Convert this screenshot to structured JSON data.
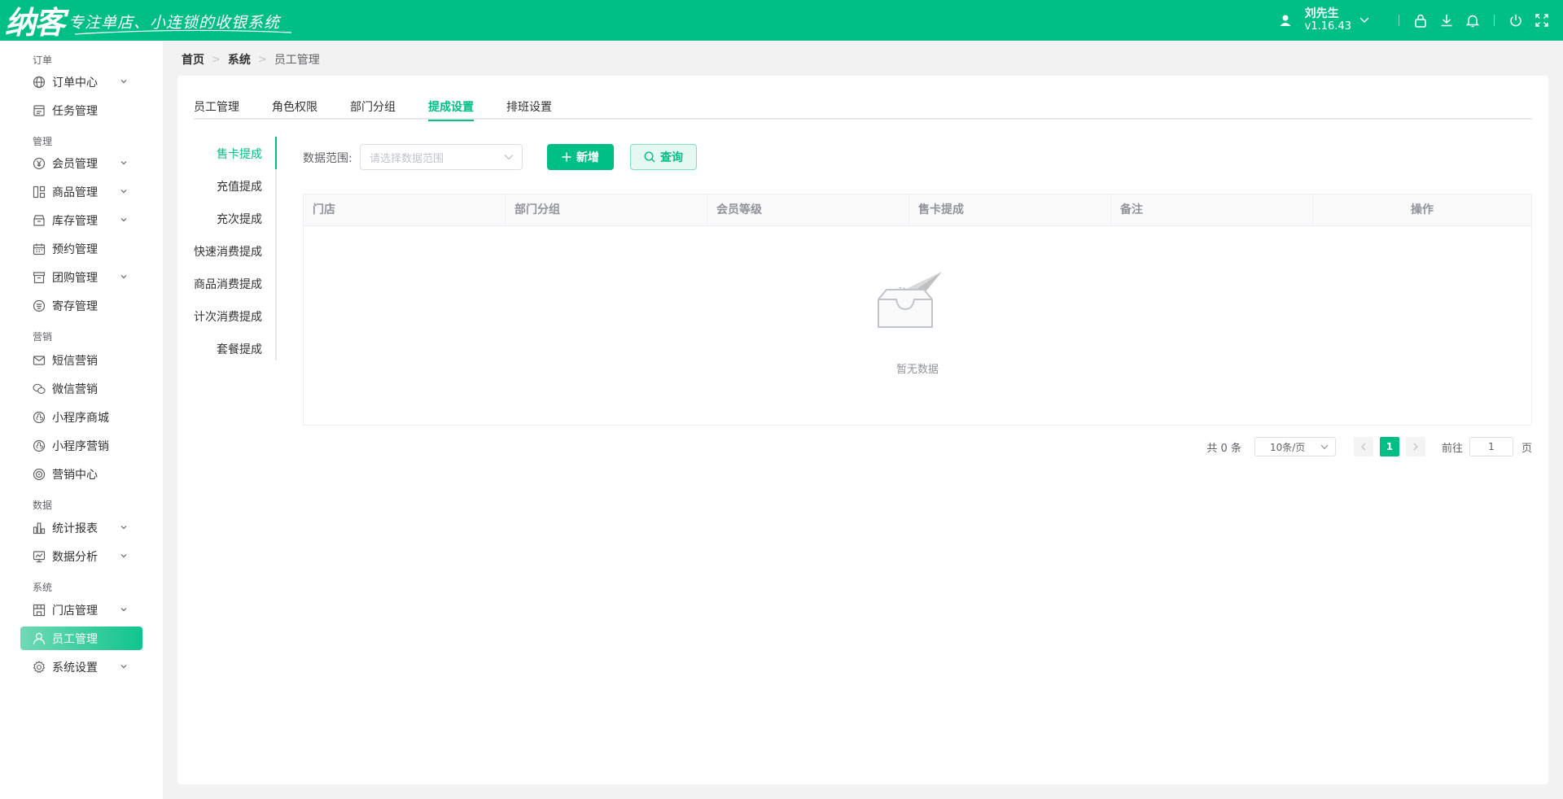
{
  "header": {
    "logo_text": "纳客",
    "slogan": "专注单店、小连锁的收银系统",
    "user_name": "刘先生",
    "version": "v1.16.43",
    "brand_color": "#00bf86",
    "icons": [
      "user-icon",
      "chevron-down-icon",
      "lock-icon",
      "download-icon",
      "bell-icon",
      "power-icon",
      "fullscreen-icon"
    ]
  },
  "sidebar": {
    "groups": {
      "order": "订单",
      "manage": "管理",
      "marketing": "营销",
      "data": "数据",
      "system": "系统"
    },
    "items": [
      {
        "label": "订单中心",
        "icon": "globe-icon",
        "has_children": true
      },
      {
        "label": "任务管理",
        "icon": "task-icon",
        "has_children": false
      },
      {
        "label": "会员管理",
        "icon": "yen-icon",
        "has_children": true
      },
      {
        "label": "商品管理",
        "icon": "grid-icon",
        "has_children": true
      },
      {
        "label": "库存管理",
        "icon": "box-icon",
        "has_children": true
      },
      {
        "label": "预约管理",
        "icon": "calendar-icon",
        "has_children": false
      },
      {
        "label": "团购管理",
        "icon": "store-icon",
        "has_children": true
      },
      {
        "label": "寄存管理",
        "icon": "deposit-icon",
        "has_children": false
      },
      {
        "label": "短信营销",
        "icon": "mail-icon",
        "has_children": false
      },
      {
        "label": "微信营销",
        "icon": "wechat-icon",
        "has_children": false
      },
      {
        "label": "小程序商城",
        "icon": "miniapp-icon",
        "has_children": false
      },
      {
        "label": "小程序营销",
        "icon": "miniapp-icon",
        "has_children": false
      },
      {
        "label": "营销中心",
        "icon": "target-icon",
        "has_children": false
      },
      {
        "label": "统计报表",
        "icon": "bar-chart-icon",
        "has_children": true
      },
      {
        "label": "数据分析",
        "icon": "monitor-icon",
        "has_children": true
      },
      {
        "label": "门店管理",
        "icon": "shop-icon",
        "has_children": true
      },
      {
        "label": "员工管理",
        "icon": "person-icon",
        "has_children": false,
        "active": true
      },
      {
        "label": "系统设置",
        "icon": "gear-icon",
        "has_children": true
      }
    ]
  },
  "breadcrumb": [
    "首页",
    "系统",
    "员工管理"
  ],
  "tabs": [
    {
      "label": "员工管理",
      "active": false
    },
    {
      "label": "角色权限",
      "active": false
    },
    {
      "label": "部门分组",
      "active": false
    },
    {
      "label": "提成设置",
      "active": true
    },
    {
      "label": "排班设置",
      "active": false
    }
  ],
  "side_tabs": [
    {
      "label": "售卡提成",
      "active": true
    },
    {
      "label": "充值提成",
      "active": false
    },
    {
      "label": "充次提成",
      "active": false
    },
    {
      "label": "快速消费提成",
      "active": false
    },
    {
      "label": "商品消费提成",
      "active": false
    },
    {
      "label": "计次消费提成",
      "active": false
    },
    {
      "label": "套餐提成",
      "active": false
    }
  ],
  "filter": {
    "label": "数据范围:",
    "placeholder": "请选择数据范围",
    "add_label": "新增",
    "query_label": "查询"
  },
  "table": {
    "columns": [
      "门店",
      "部门分组",
      "会员等级",
      "售卡提成",
      "备注",
      "操作"
    ],
    "rows": [],
    "empty_text": "暂无数据"
  },
  "pagination": {
    "total_text": "共 0 条",
    "page_size": "10条/页",
    "current_page": "1",
    "goto_label": "前往",
    "goto_value": "1",
    "page_suffix": "页"
  }
}
